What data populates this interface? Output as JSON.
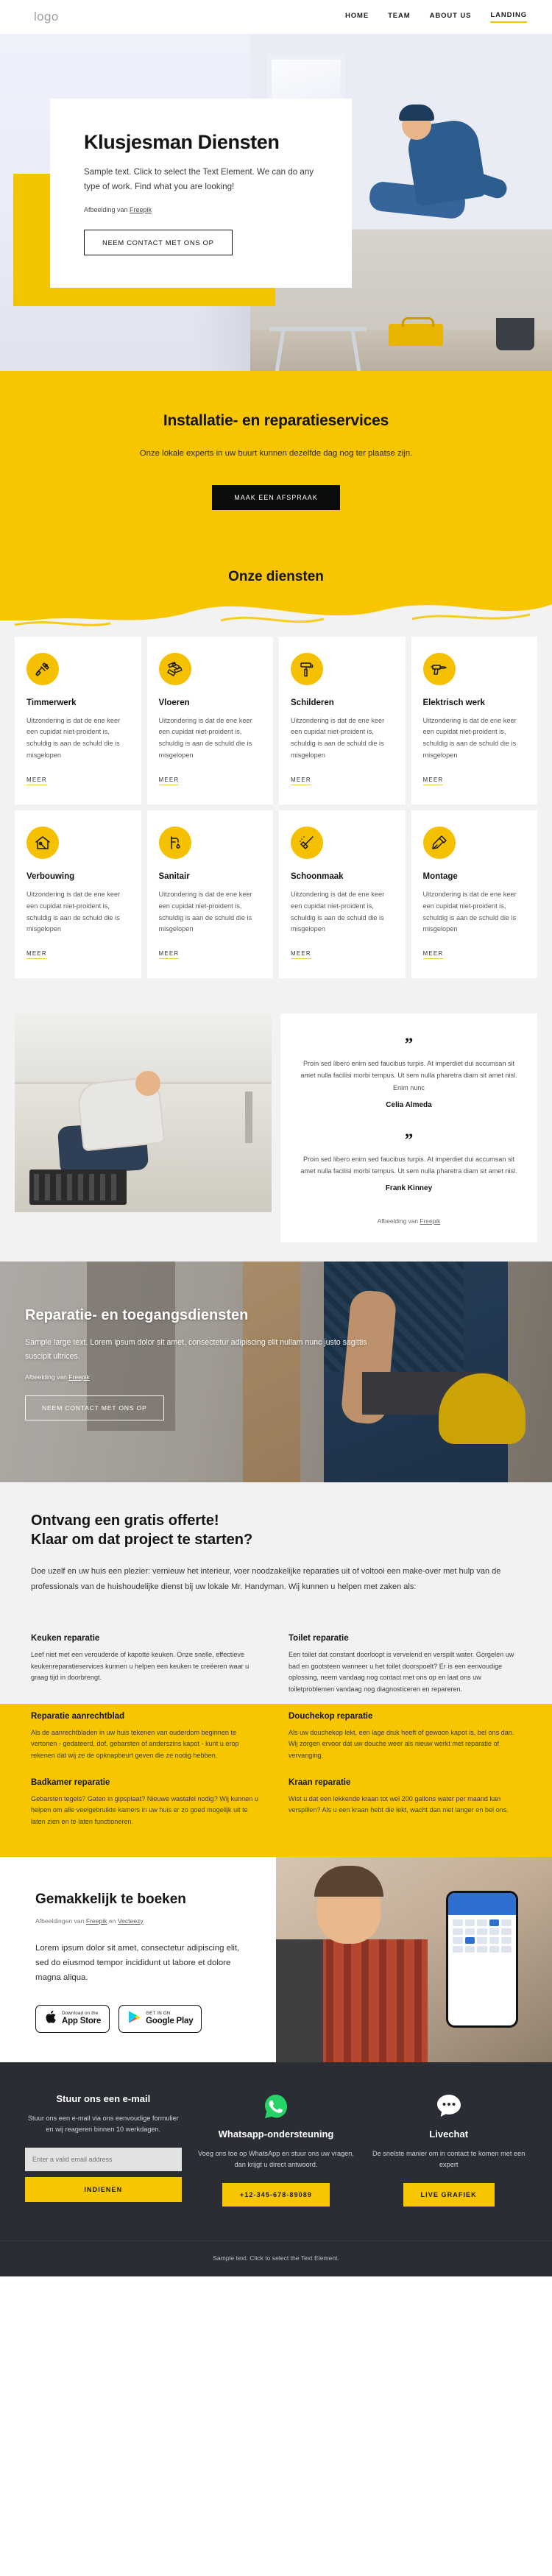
{
  "header": {
    "logo": "logo",
    "nav": [
      {
        "label": "HOME",
        "active": false
      },
      {
        "label": "TEAM",
        "active": false
      },
      {
        "label": "ABOUT US",
        "active": false
      },
      {
        "label": "LANDING",
        "active": true
      }
    ]
  },
  "hero": {
    "title": "Klusjesman Diensten",
    "subtitle": "Sample text. Click to select the Text Element. We can do any type of work. Find what you are looking!",
    "credit_prefix": "Afbeelding van ",
    "credit_link": "Freepik",
    "button": "NEEM CONTACT MET ONS OP"
  },
  "band": {
    "title": "Installatie- en reparatieservices",
    "subtitle": "Onze lokale experts in uw buurt kunnen dezelfde dag nog ter plaatse zijn.",
    "button": "MAAK EEN AFSPRAAK"
  },
  "services": {
    "title": "Onze diensten",
    "more_label": "MEER",
    "body": "Uitzondering is dat de ene keer een cupidat niet-proident is, schuldig is aan de schuld die is misgelopen",
    "items": [
      {
        "title": "Timmerwerk",
        "icon": "hammer-wrench-icon"
      },
      {
        "title": "Vloeren",
        "icon": "parquet-floor-icon"
      },
      {
        "title": "Schilderen",
        "icon": "paint-roller-icon"
      },
      {
        "title": "Elektrisch werk",
        "icon": "power-drill-icon"
      },
      {
        "title": "Verbouwing",
        "icon": "house-renovation-icon"
      },
      {
        "title": "Sanitair",
        "icon": "faucet-icon"
      },
      {
        "title": "Schoonmaak",
        "icon": "broom-icon"
      },
      {
        "title": "Montage",
        "icon": "assembly-icon"
      }
    ]
  },
  "testimonials": {
    "quote_glyph": "”",
    "items": [
      {
        "text": "Proin sed libero enim sed faucibus turpis. At imperdiet dui accumsan sit amet nulla facilisi morbi tempus. Ut sem nulla pharetra diam sit amet nisl. Enim nunc",
        "name": "Celia Almeda"
      },
      {
        "text": "Proin sed libero enim sed faucibus turpis. At imperdiet dui accumsan sit amet nulla facilisi morbi tempus. Ut sem nulla pharetra diam sit amet nisl.",
        "name": "Frank Kinney"
      }
    ],
    "credit_prefix": "Afbeelding van ",
    "credit_link": "Freepik"
  },
  "banner": {
    "title": "Reparatie- en toegangsdiensten",
    "subtitle": "Sample large text. Lorem ipsum dolor sit amet, consectetur adipiscing elit nullam nunc justo sagittis suscipit ultrices.",
    "credit_prefix": "Afbeelding van ",
    "credit_link": "Freepik",
    "button": "NEEM CONTACT MET ONS OP"
  },
  "offer": {
    "title_line1": "Ontvang een gratis offerte!",
    "title_line2": "Klaar om dat project te starten?",
    "text": "Doe uzelf en uw huis een plezier: vernieuw het interieur, voer noodzakelijke reparaties uit of voltooi een make-over met hulp van de professionals van de huishoudelijke dienst bij uw lokale Mr. Handyman. Wij kunnen u helpen met zaken als:"
  },
  "repairs": [
    {
      "title": "Keuken reparatie",
      "text": "Leef niet met een verouderde of kapotte keuken. Onze snelle, effectieve keukenreparatieservices kunnen u helpen een keuken te creëeren waar u graag tijd in doorbrengt."
    },
    {
      "title": "Toilet reparatie",
      "text": "Een toilet dat constant doorloopt is vervelend en verspilt water. Gorgelen uw bad en gootsteen wanneer u het toilet doorspoelt? Er is een eenvoudige oplossing, neem vandaag nog contact met ons op en laat ons uw toiletproblemen vandaag nog diagnosticeren en repareren."
    },
    {
      "title": "Reparatie aanrechtblad",
      "text": "Als de aanrechtbladen in uw huis tekenen van ouderdom beginnen te vertonen - gedateerd, dof, gebarsten of anderszins kapot - kunt u erop rekenen dat wij ze de opknapbeurt geven die ze nodig hebben."
    },
    {
      "title": "Douchekop reparatie",
      "text": "Als uw douchekop lekt, een lage druk heeft of gewoon kapot is, bel ons dan. Wij zorgen ervoor dat uw douche weer als nieuw werkt met reparatie of vervanging."
    },
    {
      "title": "Badkamer reparatie",
      "text": "Gebarsten tegels? Gaten in gipsplaat? Nieuwe wastafel nodig? Wij kunnen u helpen om alle veelgebruikte kamers in uw huis er zo goed mogelijk uit te laten zien en te laten functioneren."
    },
    {
      "title": "Kraan reparatie",
      "text": "Wist u dat een lekkende kraan tot wel 200 gallons water per maand kan verspillen? Als u een kraan hebt die lekt, wacht dan niet langer en bel ons."
    }
  ],
  "booking": {
    "title": "Gemakkelijk te boeken",
    "credit_prefix": "Afbeeldingen van ",
    "credit_link1": "Freepik",
    "credit_middle": " en ",
    "credit_link2": "Vecteezy",
    "text": "Lorem ipsum dolor sit amet, consectetur adipiscing elit, sed do eiusmod tempor incididunt ut labore et dolore magna aliqua.",
    "stores": [
      {
        "small": "Download on the",
        "big": "App Store",
        "icon": "apple-icon"
      },
      {
        "small": "GET IN ON",
        "big": "Google Play",
        "icon": "google-play-icon"
      }
    ]
  },
  "footer": {
    "email": {
      "title": "Stuur ons een e-mail",
      "text": "Stuur ons een e-mail via ons eenvoudige formulier en wij reageren binnen 10 werkdagen.",
      "placeholder": "Enter a valid email address",
      "value": "",
      "button": "INDIENEN"
    },
    "whatsapp": {
      "icon": "whatsapp-icon",
      "title": "Whatsapp-ondersteuning",
      "text": "Voeg ons toe op WhatsApp en stuur ons uw vragen, dan krijgt u direct antwoord.",
      "button": "+12-345-678-89089"
    },
    "livechat": {
      "icon": "chat-bubble-icon",
      "title": "Livechat",
      "text": "De snelste manier om in contact te komen met een expert",
      "button": "LIVE GRAFIEK"
    },
    "bottom": "Sample text. Click to select the Text Element."
  },
  "colors": {
    "accent": "#f7c600",
    "dark": "#2a2d33",
    "black": "#0c0c0c",
    "whatsapp_green": "#25d366"
  }
}
